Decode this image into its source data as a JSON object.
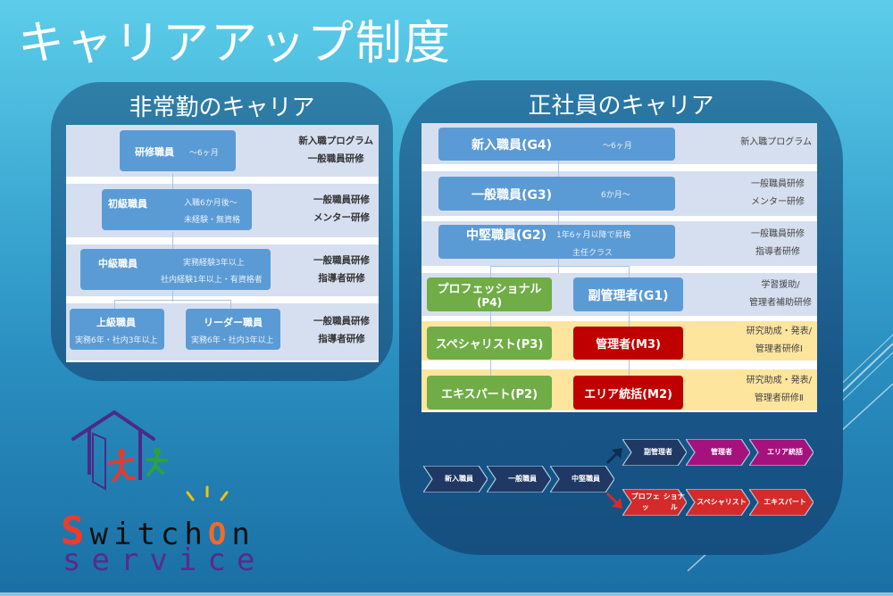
{
  "title": "キャリアアップ制度",
  "part_time": {
    "title": "非常勤のキャリア",
    "rows": [
      {
        "boxes": [
          {
            "name": "研修職員",
            "sub": [
              "〜6ヶ月"
            ]
          }
        ],
        "training": [
          "新入職プログラム",
          "一般職員研修"
        ]
      },
      {
        "boxes": [
          {
            "name": "初級職員",
            "sub": [
              "入職6か月後〜",
              "未経験・無資格"
            ]
          }
        ],
        "training": [
          "一般職員研修",
          "メンター研修"
        ]
      },
      {
        "boxes": [
          {
            "name": "中級職員",
            "sub": [
              "実務経験3年以上",
              "社内経験1年以上・有資格者"
            ]
          }
        ],
        "training": [
          "一般職員研修",
          "指導者研修"
        ]
      },
      {
        "boxes": [
          {
            "name": "上級職員",
            "sub": [
              "実務6年・社内3年以上"
            ]
          },
          {
            "name": "リーダー職員",
            "sub": [
              "実務6年・社内3年以上"
            ]
          }
        ],
        "training": [
          "一般職員研修",
          "指導者研修"
        ]
      }
    ]
  },
  "full_time": {
    "title": "正社員のキャリア",
    "rows": [
      {
        "boxes": [
          {
            "name": "新入職員(G4)",
            "sub": "〜6ヶ月"
          }
        ],
        "training": [
          "新入職プログラム"
        ]
      },
      {
        "boxes": [
          {
            "name": "一般職員(G3)",
            "sub": "6か月〜"
          }
        ],
        "training": [
          "一般職員研修",
          "メンター研修"
        ]
      },
      {
        "boxes": [
          {
            "name": "中堅職員(G2)",
            "sub": "1年6ヶ月以降で昇格",
            "sub2": "主任クラス"
          }
        ],
        "training": [
          "一般職員研修",
          "指導者研修"
        ]
      },
      {
        "boxes": [
          {
            "name": "プロフェッショナル",
            "name2": "(P4)",
            "color": "green"
          },
          {
            "name": "副管理者(G1)",
            "color": "blue"
          }
        ],
        "training": [
          "学習援助/",
          "管理者補助研修"
        ]
      },
      {
        "boxes": [
          {
            "name": "スペシャリスト(P3)",
            "color": "green"
          },
          {
            "name": "管理者(M3)",
            "color": "red"
          }
        ],
        "training": [
          "研究助成・発表/",
          "管理者研修Ⅰ"
        ]
      },
      {
        "boxes": [
          {
            "name": "エキスパート(P2)",
            "color": "green"
          },
          {
            "name": "エリア統括(M2)",
            "color": "red"
          }
        ],
        "training": [
          "研究助成・発表/",
          "管理者研修Ⅱ"
        ]
      }
    ],
    "flow": {
      "base": [
        "新入職員",
        "一般職員",
        "中堅職員"
      ],
      "management": [
        "副管理者",
        "管理者",
        "エリア統括"
      ],
      "specialist": [
        [
          "プロフェッ",
          "ショナル"
        ],
        [
          "スペシャリ",
          "スト"
        ],
        [
          "エキスパー",
          "ト"
        ]
      ]
    }
  },
  "logo": {
    "line1_first": "S",
    "line1_rest": "witch",
    "line1_o": "O",
    "line1_end": "n",
    "line2": "service"
  },
  "colors": {
    "box_blue": "#5b9bd5",
    "green": "#70ad47",
    "red": "#c00000",
    "navy": "#1f3864",
    "magenta": "#a5127e",
    "flow_red": "#d42a2a"
  }
}
